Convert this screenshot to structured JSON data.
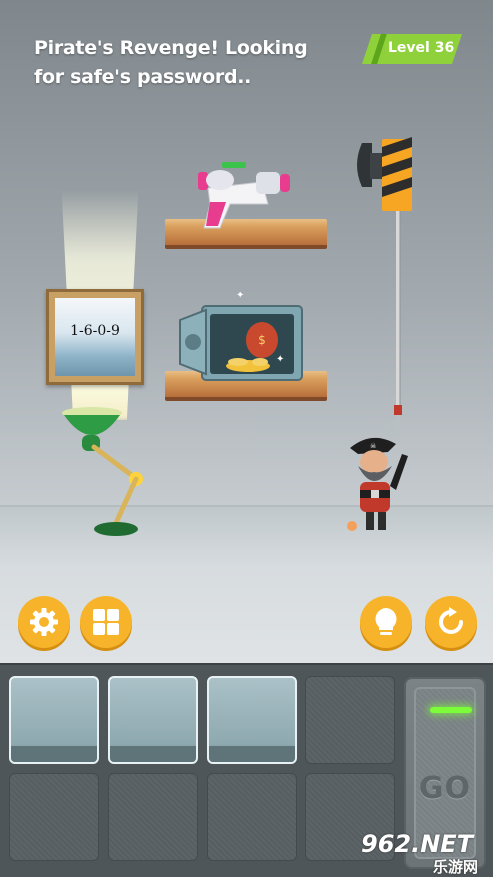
{
  "header": {
    "title": "Pirate's Revenge! Looking for safe's password..",
    "level_label": "Level 36"
  },
  "scene": {
    "picture_code": "1-6-0-9"
  },
  "controls": {
    "settings_icon": "gear-icon",
    "menu_icon": "grid-icon",
    "hint_icon": "lightbulb-icon",
    "restart_icon": "restart-icon"
  },
  "inventory": {
    "slots": [
      {
        "filled": true
      },
      {
        "filled": true
      },
      {
        "filled": true
      },
      {
        "filled": false
      },
      {
        "filled": false
      },
      {
        "filled": false
      },
      {
        "filled": false
      },
      {
        "filled": false
      }
    ],
    "go_label": "GO"
  },
  "watermark": {
    "logo": "962.NET",
    "sub": "乐游网"
  },
  "colors": {
    "accent_orange": "#f7b42a",
    "level_green": "#8fd13a",
    "go_light": "#7dfc3a"
  }
}
